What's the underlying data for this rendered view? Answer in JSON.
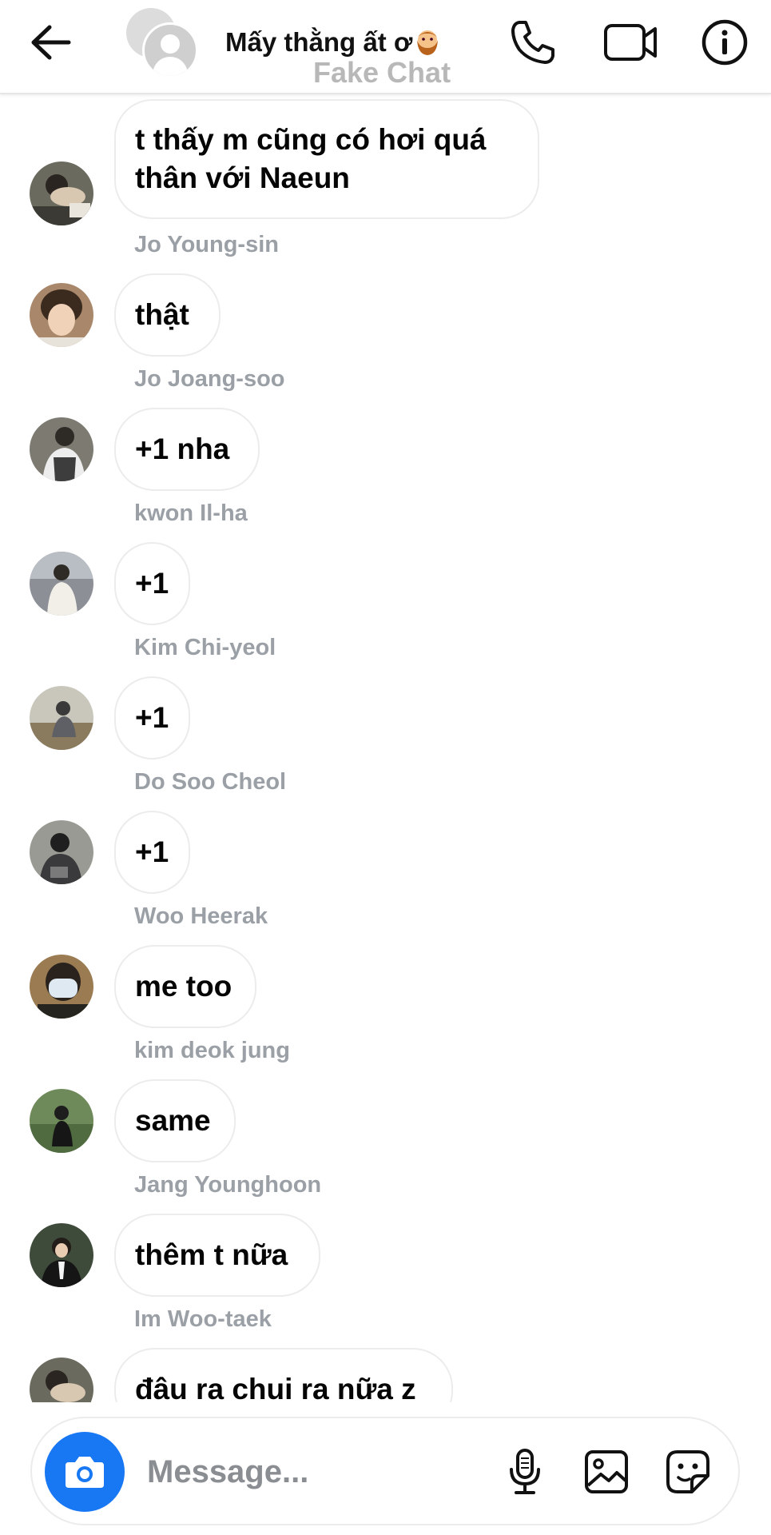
{
  "header": {
    "title": "Mấy thằng ất ơ",
    "watermark": "Fake Chat",
    "icons": [
      "back-arrow-icon",
      "group-avatar",
      "bearded-face-emoji",
      "phone-icon",
      "video-camera-icon",
      "info-icon"
    ]
  },
  "messages": [
    {
      "sender": "",
      "text": "t thấy m cũng có hơi quá thân với Naeun",
      "avatar_color": "#6b6a5e"
    },
    {
      "sender": "Jo Young-sin",
      "text": "thật",
      "avatar_color": "#a8876a"
    },
    {
      "sender": "Jo Joang-soo",
      "text": "+1 nha",
      "avatar_color": "#7d7a72"
    },
    {
      "sender": "kwon Il-ha",
      "text": "+1",
      "avatar_color": "#8c8f96"
    },
    {
      "sender": "Kim Chi-yeol",
      "text": "+1",
      "avatar_color": "#8a8470"
    },
    {
      "sender": "Do Soo Cheol",
      "text": "+1",
      "avatar_color": "#5e5e5e"
    },
    {
      "sender": "Woo Heerak",
      "text": "me too",
      "avatar_color": "#9a7b52"
    },
    {
      "sender": "kim deok jung",
      "text": "same",
      "avatar_color": "#4f6b3f"
    },
    {
      "sender": "Jang Younghoon",
      "text": "thêm t nữa",
      "avatar_color": "#2f2f2f"
    },
    {
      "sender": "Im Woo-taek",
      "text": "đâu ra chui ra nữa z",
      "avatar_color": "#6b6a5e"
    }
  ],
  "composer": {
    "placeholder": "Message...",
    "camera_color": "#1877f2",
    "icons": [
      "camera-icon",
      "microphone-icon",
      "gallery-icon",
      "sticker-icon"
    ]
  }
}
